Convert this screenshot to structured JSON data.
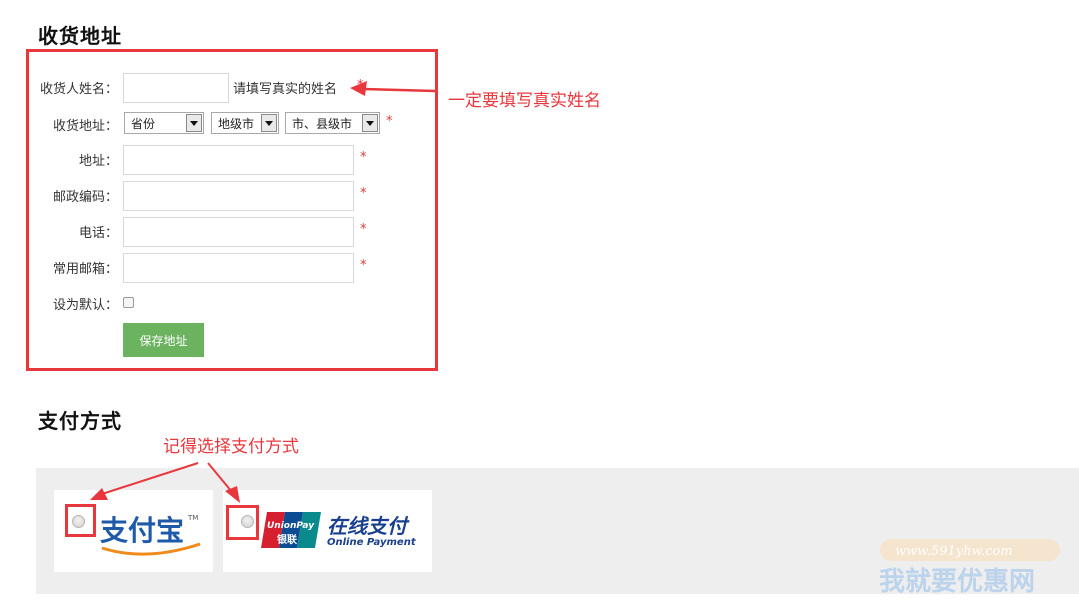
{
  "address_section": {
    "title": "收货地址",
    "fields": {
      "name_label": "收货人姓名：",
      "name_hint": "请填写真实的姓名",
      "region_label": "收货地址：",
      "province_select": "省份",
      "city_select": "地级市",
      "county_select": "市、县级市",
      "address_label": "地址：",
      "postcode_label": "邮政编码：",
      "phone_label": "电话：",
      "email_label": "常用邮箱：",
      "default_label": "设为默认：",
      "required_mark": "*"
    },
    "save_button": "保存地址"
  },
  "annotations": {
    "name_note": "一定要填写真实姓名",
    "payment_note": "记得选择支付方式",
    "accent_color": "#e8373d"
  },
  "payment_section": {
    "title": "支付方式",
    "options": [
      {
        "logo_text": "支付宝",
        "logo_tm": "TM"
      },
      {
        "logo_badge_top": "UnionPay",
        "logo_badge_bottom": "银联",
        "logo_title": "在线支付",
        "logo_subtitle": "Online Payment"
      }
    ]
  },
  "watermark": {
    "url": "www.591yhw.com",
    "brand": "我就要优惠网"
  }
}
